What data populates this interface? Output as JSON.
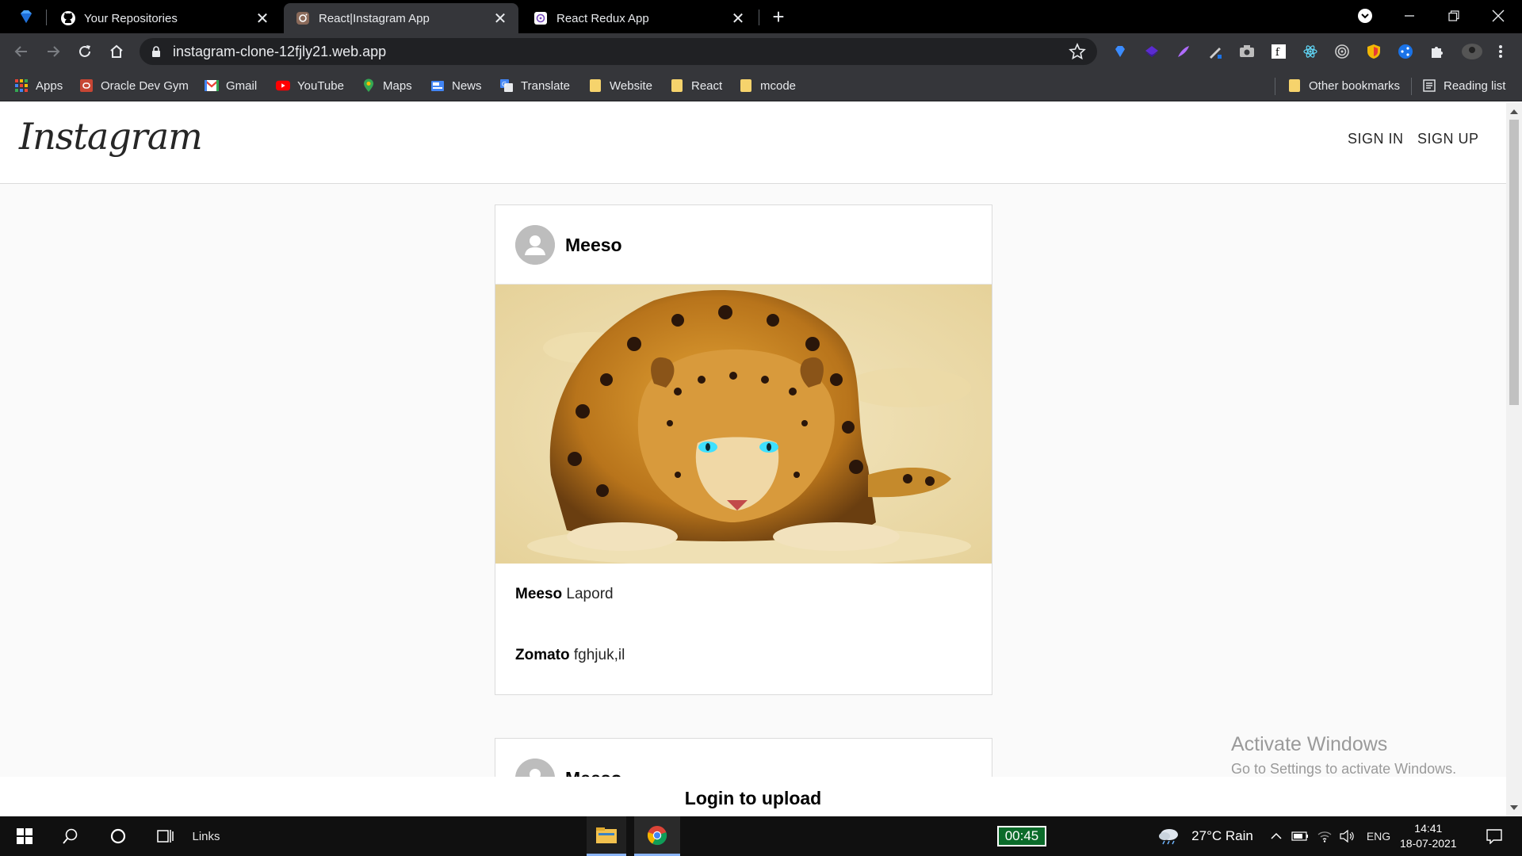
{
  "browser": {
    "tabs": [
      {
        "title": "Your Repositories",
        "icon": "github-icon",
        "active": false
      },
      {
        "title": "React|Instagram App",
        "icon": "instagram-icon",
        "active": true
      },
      {
        "title": "React Redux App",
        "icon": "redux-icon",
        "active": false
      }
    ],
    "url": "instagram-clone-12fjly21.web.app",
    "bookmarks": [
      {
        "label": "Apps",
        "icon": "apps-grid-icon"
      },
      {
        "label": "Oracle Dev Gym",
        "icon": "oracle-icon"
      },
      {
        "label": "Gmail",
        "icon": "gmail-icon"
      },
      {
        "label": "YouTube",
        "icon": "youtube-icon"
      },
      {
        "label": "Maps",
        "icon": "maps-icon"
      },
      {
        "label": "News",
        "icon": "news-icon"
      },
      {
        "label": "Translate",
        "icon": "translate-icon"
      },
      {
        "label": "Website",
        "icon": "folder-icon"
      },
      {
        "label": "React",
        "icon": "folder-icon"
      },
      {
        "label": "mcode",
        "icon": "folder-icon"
      }
    ],
    "other_bookmarks": "Other bookmarks",
    "reading_list": "Reading list"
  },
  "app": {
    "logo": "Instagram",
    "sign_in": "SIGN IN",
    "sign_up": "SIGN UP",
    "posts": [
      {
        "username": "Meeso",
        "image_alt": "leopard",
        "comments": [
          {
            "user": "Meeso",
            "text": "Lapord"
          },
          {
            "user": "Zomato",
            "text": "fghjuk,il"
          }
        ]
      },
      {
        "username": "Meeso"
      }
    ],
    "login_prompt": "Login to upload"
  },
  "watermark": {
    "title": "Activate Windows",
    "subtitle": "Go to Settings to activate Windows."
  },
  "taskbar": {
    "links_label": "Links",
    "timer": "00:45",
    "weather": "27°C  Rain",
    "language": "ENG",
    "time": "14:41",
    "date": "18-07-2021"
  },
  "colors": {
    "tabstrip": "#000000",
    "toolbar": "#35363a",
    "page_bg": "#fafafa",
    "border": "#dbdbdb"
  }
}
